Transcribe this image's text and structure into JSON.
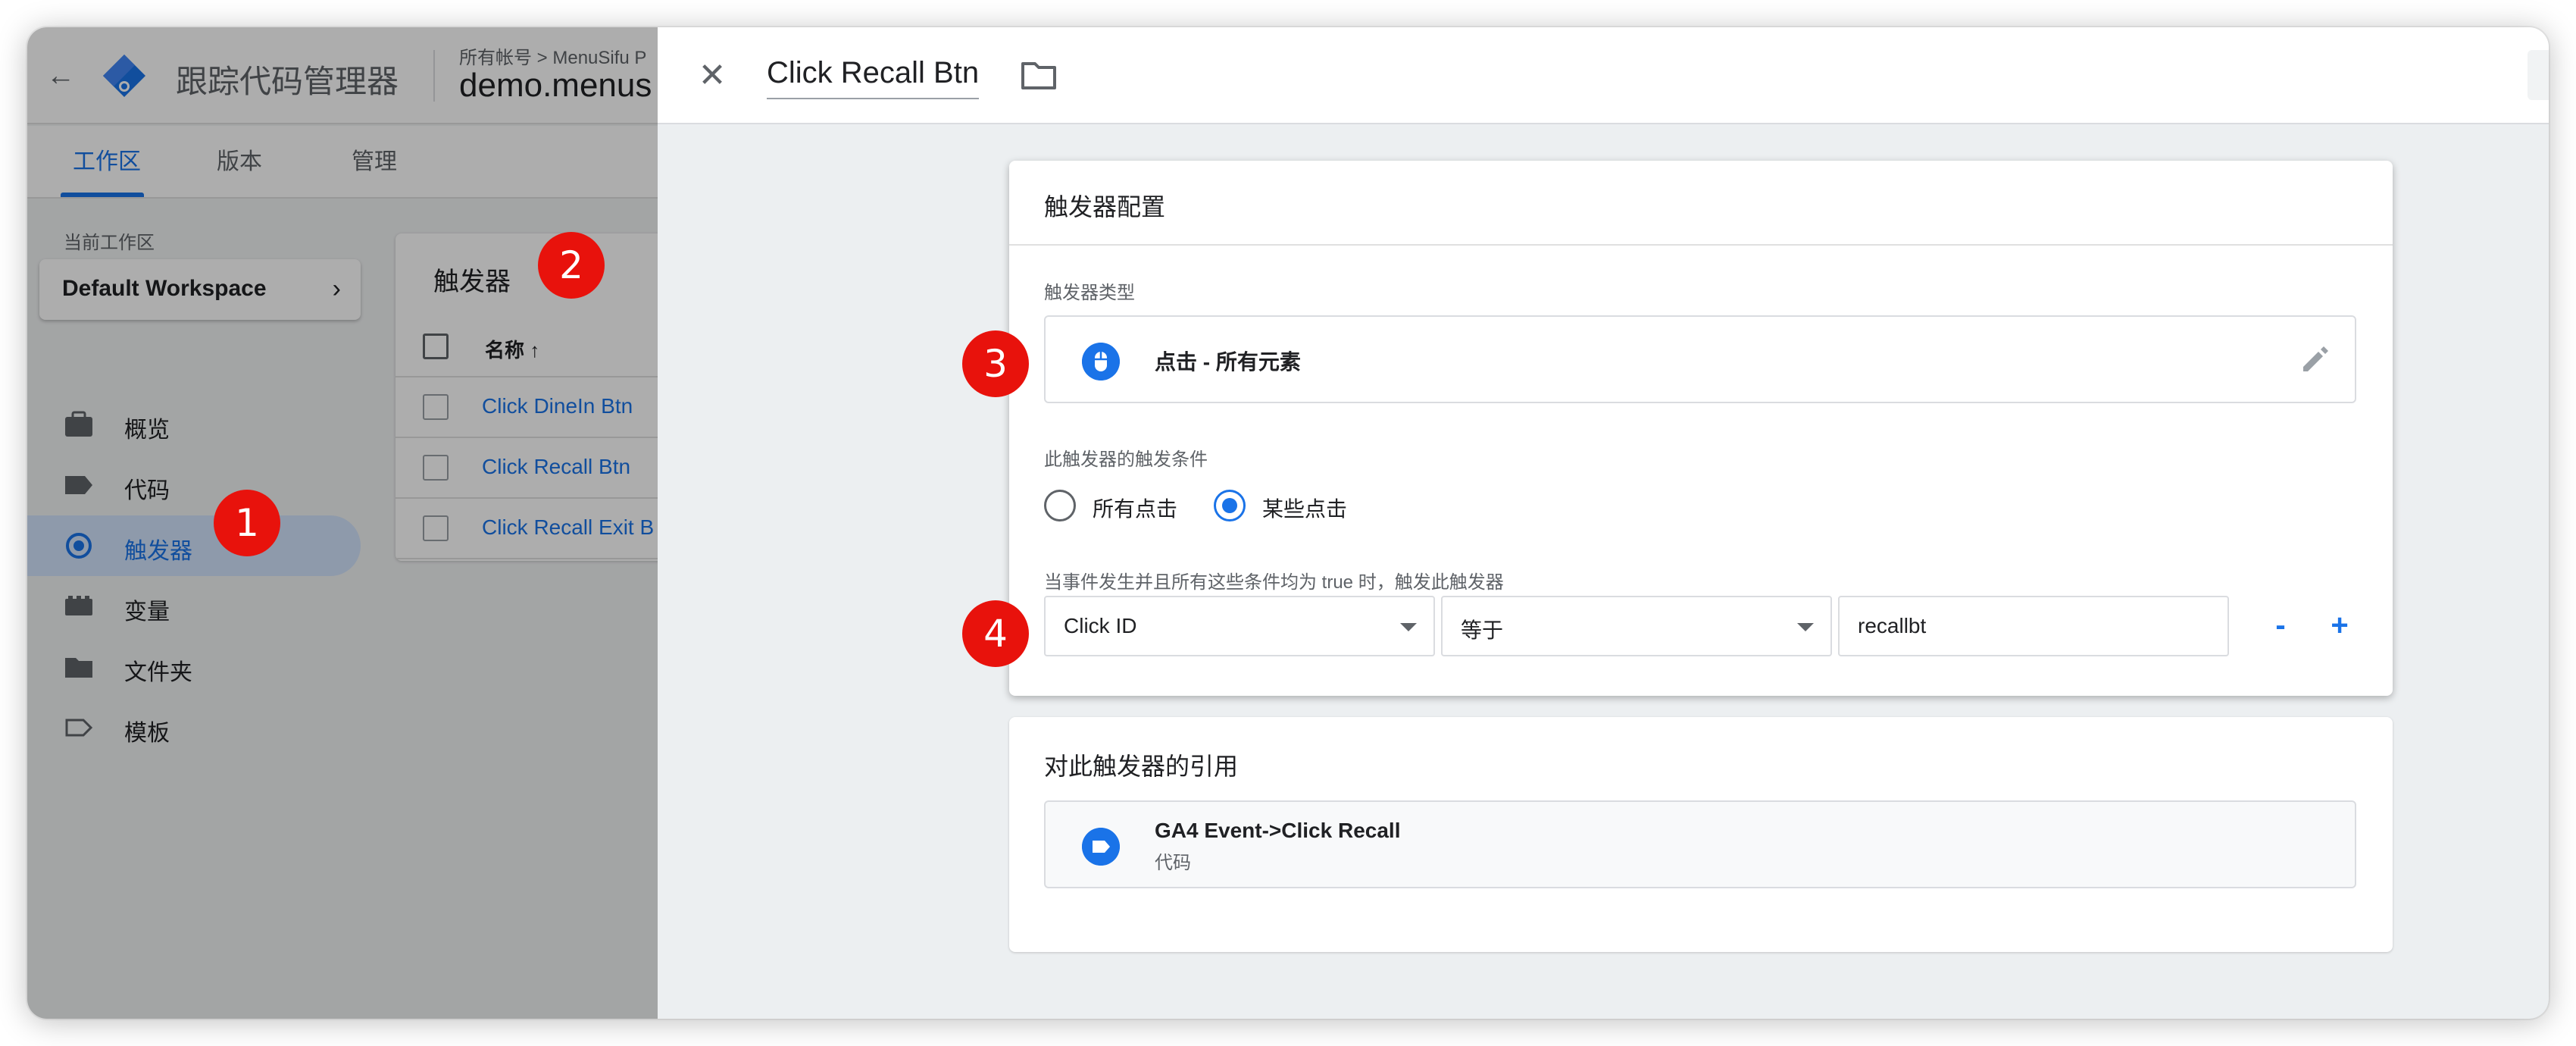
{
  "header": {
    "product_title": "跟踪代码管理器",
    "account_breadcrumb": "所有帐号 > MenuSifu P",
    "container_name": "demo.menus"
  },
  "tabs": [
    {
      "label": "工作区",
      "active": true
    },
    {
      "label": "版本",
      "active": false
    },
    {
      "label": "管理",
      "active": false
    }
  ],
  "workspace": {
    "label": "当前工作区",
    "name": "Default Workspace"
  },
  "sidebar": {
    "items": [
      {
        "label": "概览",
        "icon": "briefcase-icon",
        "active": false
      },
      {
        "label": "代码",
        "icon": "tag-icon",
        "active": false
      },
      {
        "label": "触发器",
        "icon": "trigger-icon",
        "active": true
      },
      {
        "label": "变量",
        "icon": "variable-icon",
        "active": false
      },
      {
        "label": "文件夹",
        "icon": "folder-icon",
        "active": false
      },
      {
        "label": "模板",
        "icon": "template-icon",
        "active": false
      }
    ]
  },
  "triggers_list": {
    "title": "触发器",
    "column_name": "名称 ↑",
    "rows": [
      "Click DineIn Btn",
      "Click Recall Btn",
      "Click Recall Exit B"
    ]
  },
  "badges": [
    "1",
    "2",
    "3",
    "4"
  ],
  "panel": {
    "title": "Click Recall Btn",
    "config": {
      "title": "触发器配置",
      "type_label": "触发器类型",
      "type_value": "点击 - 所有元素",
      "fire_on_label": "此触发器的触发条件",
      "fire_options": [
        {
          "label": "所有点击",
          "checked": false
        },
        {
          "label": "某些点击",
          "checked": true
        }
      ],
      "condition_label": "当事件发生并且所有这些条件均为 true 时，触发此触发器",
      "condition": {
        "variable": "Click ID",
        "operator": "等于",
        "value": "recallbt"
      },
      "remove_label": "-",
      "add_label": "+"
    },
    "references": {
      "title": "对此触发器的引用",
      "items": [
        {
          "name": "GA4 Event->Click Recall",
          "type": "代码"
        }
      ]
    }
  },
  "colors": {
    "accent": "#1a73e8",
    "badge": "#e8120c",
    "active_nav_bg": "#d2e3fc"
  }
}
